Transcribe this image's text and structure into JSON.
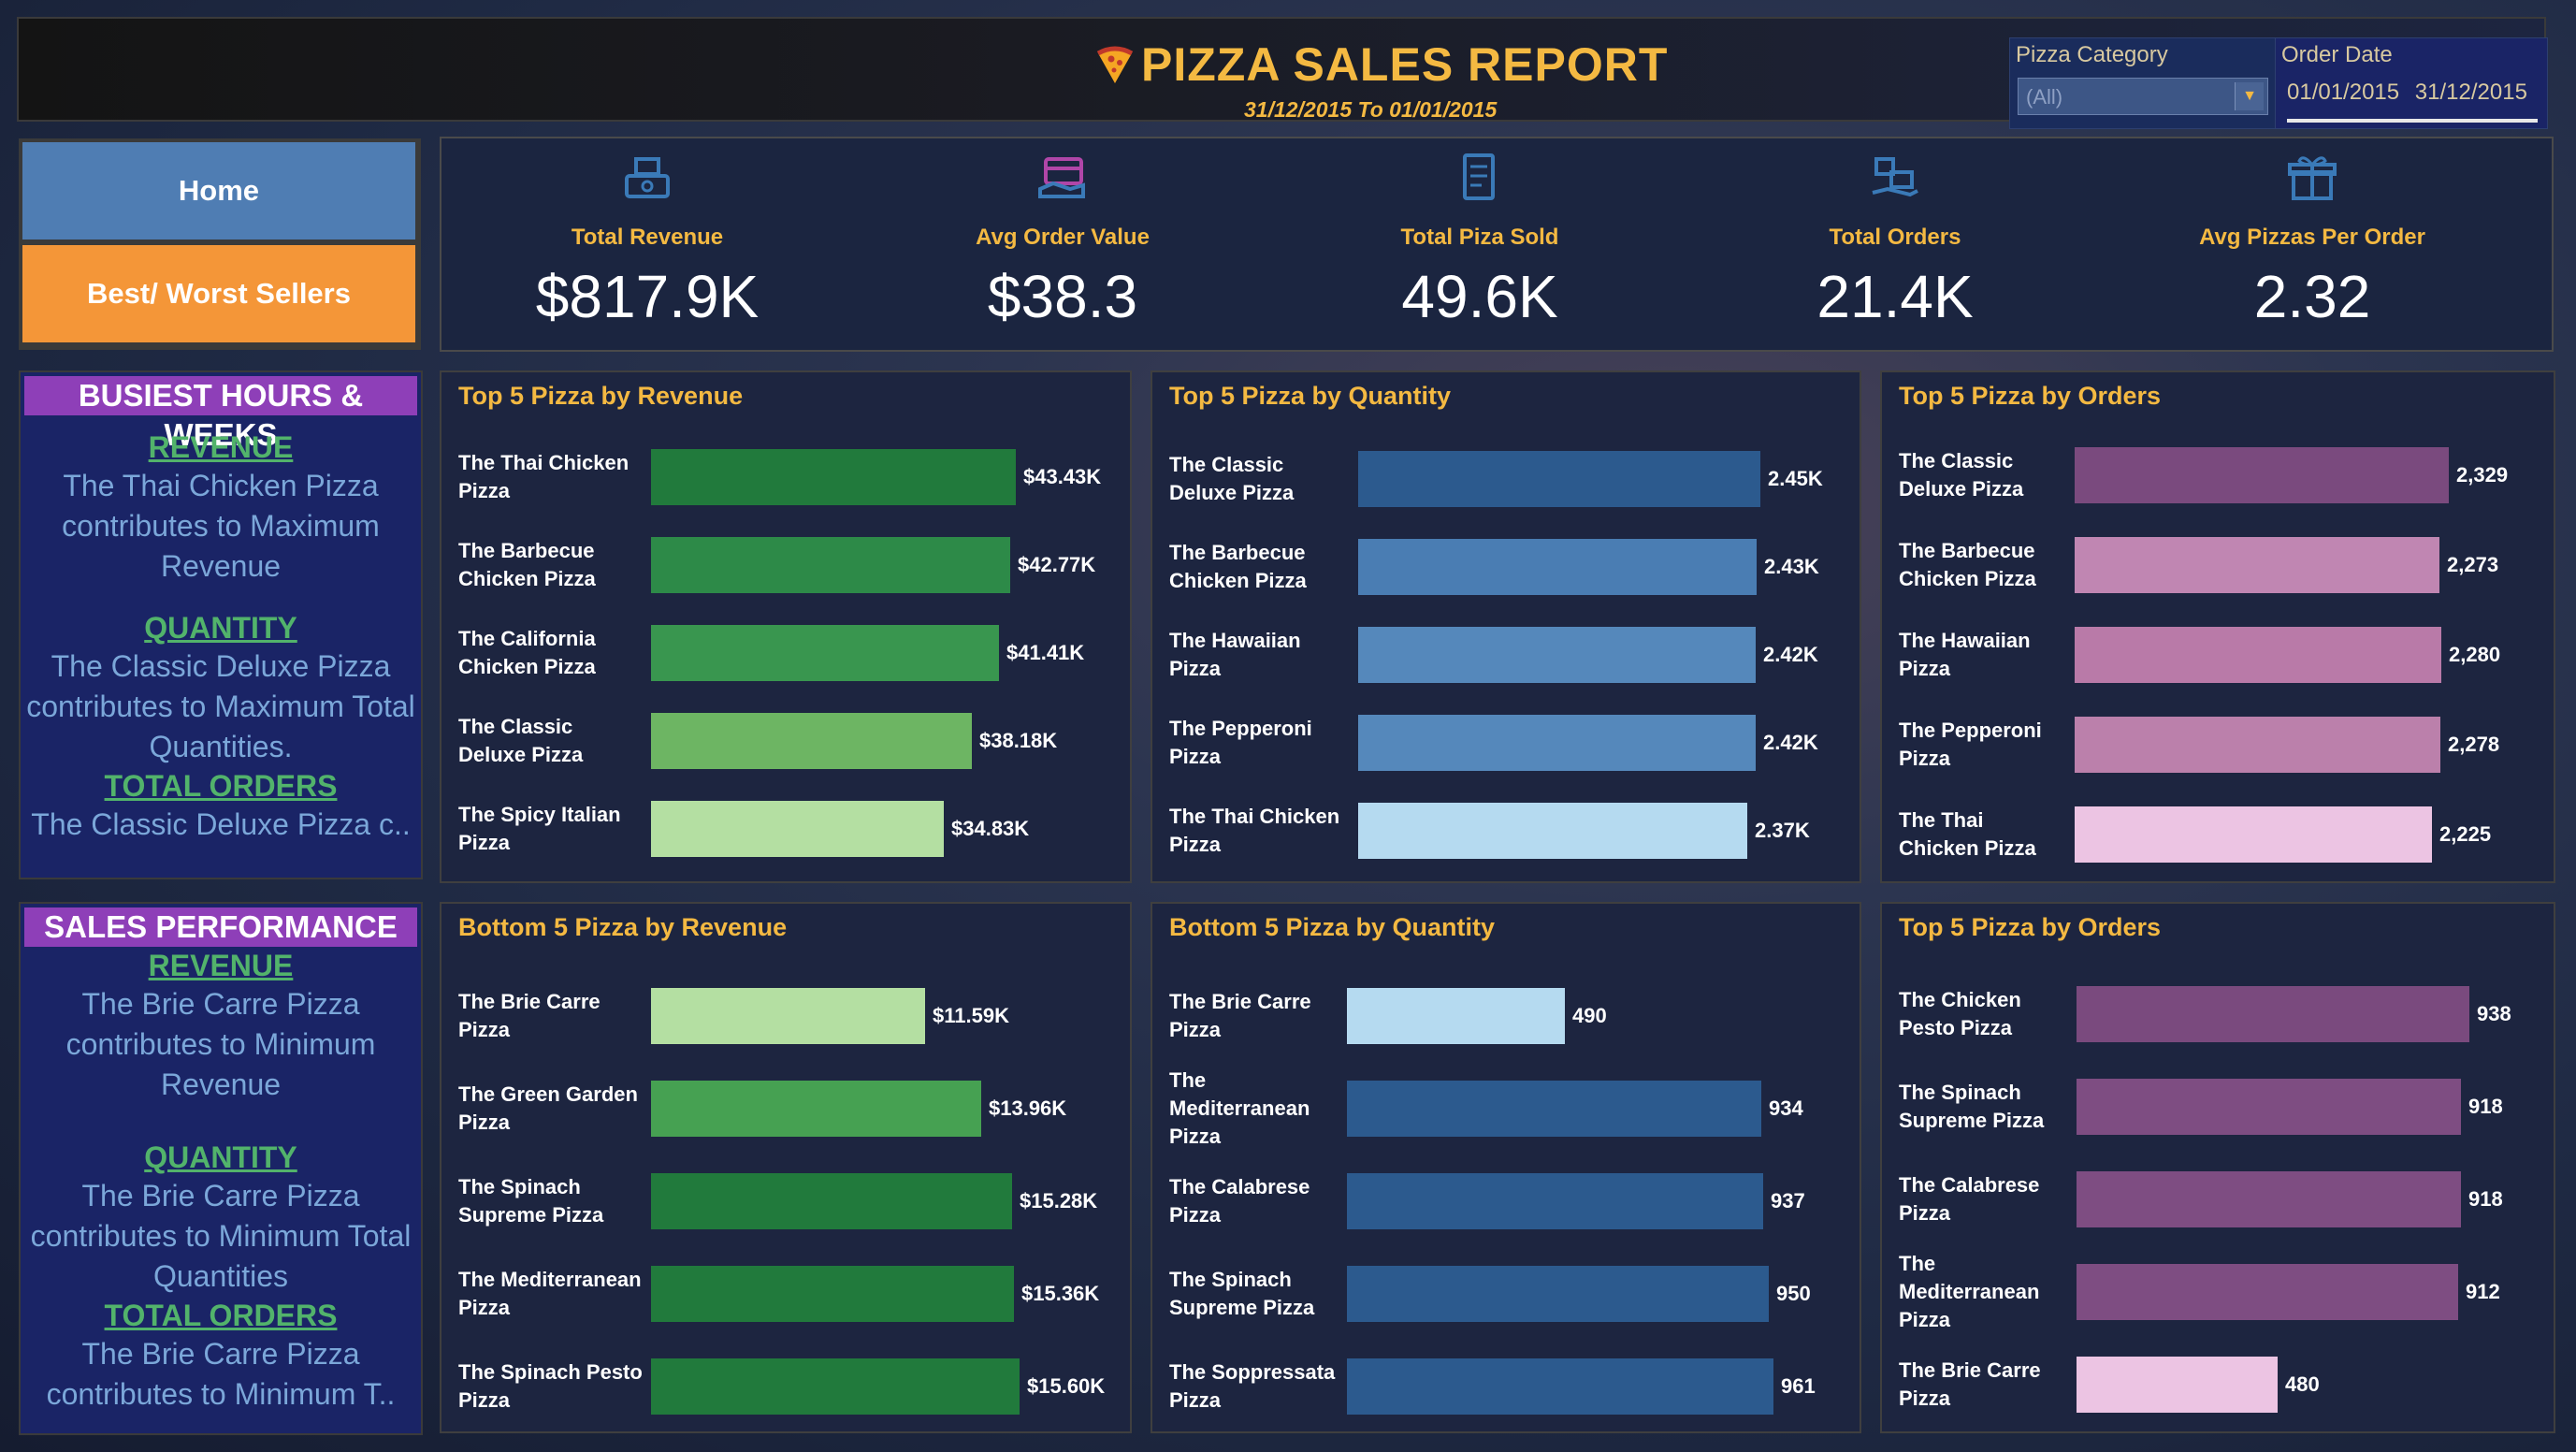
{
  "header": {
    "title": "PIZZA SALES REPORT",
    "subtitle": "31/12/2015 To 01/01/2015",
    "filters": {
      "category_label": "Pizza Category",
      "category_value": "(All)",
      "date_label": "Order Date",
      "date_from": "01/01/2015",
      "date_to": "31/12/2015"
    }
  },
  "nav": {
    "home": "Home",
    "best_worst": "Best/ Worst Sellers"
  },
  "kpis": [
    {
      "label": "Total Revenue",
      "value": "$817.9K",
      "icon": "money-register-icon",
      "color": "#3a7ab8"
    },
    {
      "label": "Avg Order Value",
      "value": "$38.3",
      "icon": "card-payment-icon",
      "color": "#b046a8"
    },
    {
      "label": "Total Piza Sold",
      "value": "49.6K",
      "icon": "receipt-list-icon",
      "color": "#3a7ab8"
    },
    {
      "label": "Total Orders",
      "value": "21.4K",
      "icon": "delivery-boxes-icon",
      "color": "#3a7ab8"
    },
    {
      "label": "Avg Pizzas Per Order",
      "value": "2.32",
      "icon": "gift-box-icon",
      "color": "#3a7ab8"
    }
  ],
  "busiest": {
    "heading": "BUSIEST HOURS & WEEKS",
    "revenue_head": "REVENUE",
    "revenue_text": "The Thai Chicken Pizza contributes to Maximum Revenue",
    "quantity_head": "QUANTITY",
    "quantity_text": "The Classic Deluxe Pizza contributes to Maximum Total Quantities.",
    "orders_head": "TOTAL ORDERS",
    "orders_text": "The Classic Deluxe Pizza c.."
  },
  "performance": {
    "heading": "SALES PERFORMANCE",
    "revenue_head": "REVENUE",
    "revenue_text": "The Brie Carre Pizza contributes to Minimum Revenue",
    "quantity_head": "QUANTITY",
    "quantity_text": "The Brie Carre Pizza contributes to Minimum Total Quantities",
    "orders_head": "TOTAL ORDERS",
    "orders_text": "The Brie Carre Pizza contributes to Minimum T.."
  },
  "chart_data": [
    {
      "type": "bar",
      "orientation": "horizontal",
      "title": "Top 5 Pizza by Revenue",
      "categories": [
        "The Thai Chicken Pizza",
        "The Barbecue Chicken Pizza",
        "The California Chicken Pizza",
        "The Classic Deluxe Pizza",
        "The Spicy Italian Pizza"
      ],
      "values": [
        43430,
        42770,
        41410,
        38180,
        34830
      ],
      "labels": [
        "$43.43K",
        "$42.77K",
        "$41.41K",
        "$38.18K",
        "$34.83K"
      ],
      "colors": [
        "#217a3c",
        "#2d8a48",
        "#39964f",
        "#6db563",
        "#b4dfa2"
      ]
    },
    {
      "type": "bar",
      "orientation": "horizontal",
      "title": "Top 5 Pizza by Quantity",
      "categories": [
        "The Classic Deluxe Pizza",
        "The Barbecue Chicken Pizza",
        "The Hawaiian Pizza",
        "The Pepperoni Pizza",
        "The Thai Chicken Pizza"
      ],
      "values": [
        2450,
        2430,
        2420,
        2420,
        2370
      ],
      "labels": [
        "2.45K",
        "2.43K",
        "2.42K",
        "2.42K",
        "2.37K"
      ],
      "colors": [
        "#2c5a8e",
        "#4a7db3",
        "#5588bb",
        "#5588bb",
        "#b5daf0"
      ]
    },
    {
      "type": "bar",
      "orientation": "horizontal",
      "title": "Top 5 Pizza by Orders",
      "categories": [
        "The Classic Deluxe Pizza",
        "The Barbecue Chicken Pizza",
        "The Hawaiian Pizza",
        "The Pepperoni Pizza",
        "The Thai Chicken Pizza"
      ],
      "values": [
        2329,
        2273,
        2280,
        2278,
        2225
      ],
      "labels": [
        "2,329",
        "2,273",
        "2,280",
        "2,278",
        "2,225"
      ],
      "colors": [
        "#7a4a7e",
        "#c086b2",
        "#b97aa8",
        "#bb80ab",
        "#ecc4e3"
      ]
    },
    {
      "type": "bar",
      "orientation": "horizontal",
      "title": "Bottom 5 Pizza by Revenue",
      "categories": [
        "The Brie Carre Pizza",
        "The Green Garden Pizza",
        "The Spinach Supreme Pizza",
        "The Mediterranean Pizza",
        "The Spinach Pesto Pizza"
      ],
      "values": [
        11590,
        13960,
        15280,
        15360,
        15600
      ],
      "labels": [
        "$11.59K",
        "$13.96K",
        "$15.28K",
        "$15.36K",
        "$15.60K"
      ],
      "colors": [
        "#b4dfa2",
        "#46a152",
        "#217a3c",
        "#217a3c",
        "#217a3c"
      ]
    },
    {
      "type": "bar",
      "orientation": "horizontal",
      "title": "Bottom 5 Pizza by Quantity",
      "categories": [
        "The Brie Carre Pizza",
        "The Mediterranean Pizza",
        "The Calabrese Pizza",
        "The Spinach Supreme Pizza",
        "The Soppressata Pizza"
      ],
      "values": [
        490,
        934,
        937,
        950,
        961
      ],
      "labels": [
        "490",
        "934",
        "937",
        "950",
        "961"
      ],
      "colors": [
        "#b5daf0",
        "#2c5a8e",
        "#2c5a8e",
        "#2c5a8e",
        "#2c5a8e"
      ]
    },
    {
      "type": "bar",
      "orientation": "horizontal",
      "title": "Top 5 Pizza by Orders",
      "categories": [
        "The Chicken Pesto Pizza",
        "The Spinach Supreme Pizza",
        "The Calabrese Pizza",
        "The Mediterranean Pizza",
        "The Brie Carre Pizza"
      ],
      "values": [
        938,
        918,
        918,
        912,
        480
      ],
      "labels": [
        "938",
        "918",
        "918",
        "912",
        "480"
      ],
      "colors": [
        "#7a4a7e",
        "#7e4d82",
        "#7e4d82",
        "#7e4d82",
        "#ecc4e3"
      ]
    }
  ]
}
